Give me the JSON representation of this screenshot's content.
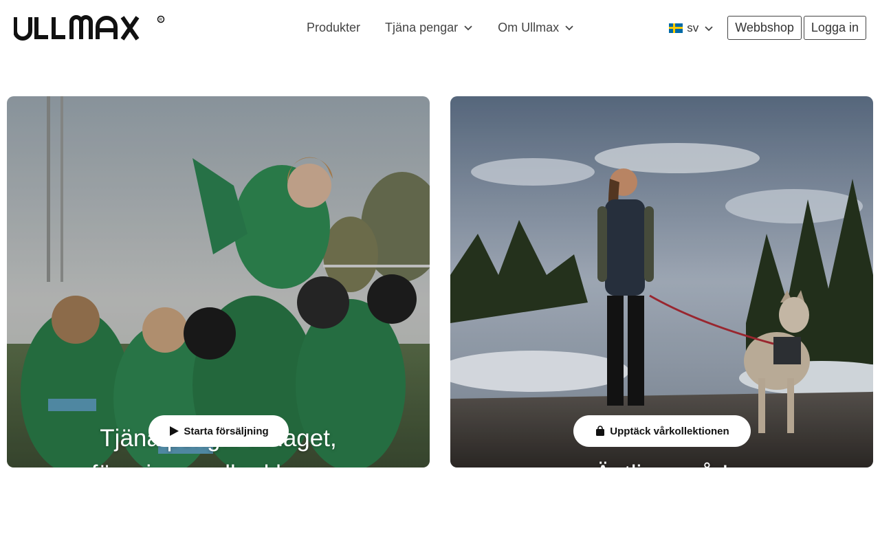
{
  "brand": {
    "logo_text": "ULLMAX",
    "registered_mark": "®"
  },
  "nav": {
    "items": [
      {
        "label": "Produkter",
        "has_dropdown": false
      },
      {
        "label": "Tjäna pengar",
        "has_dropdown": true,
        "icon": "chevron-down-icon"
      },
      {
        "label": "Om Ullmax",
        "has_dropdown": true,
        "icon": "chevron-down-icon"
      }
    ]
  },
  "header_right": {
    "language": {
      "code": "sv",
      "flag": "sweden-flag-icon"
    },
    "webshop_label": "Webbshop",
    "login_label": "Logga in"
  },
  "hero_cards": [
    {
      "line1": "Tjäna pengar till laget,",
      "line2": "föreningen eller klassen",
      "button_label": "Starta försäljning",
      "button_icon": "play-icon",
      "image": "team-celebration-photo"
    },
    {
      "line1": "Äntligen vår!",
      "button_label": "Upptäck vårkollektionen",
      "button_icon": "shopping-bag-icon",
      "image": "woman-with-dog-photo"
    }
  ],
  "colors": {
    "text": "#222222",
    "button_bg": "#ffffff",
    "photo_left": "#2f7a4a",
    "photo_right": "#4a5a6e"
  }
}
